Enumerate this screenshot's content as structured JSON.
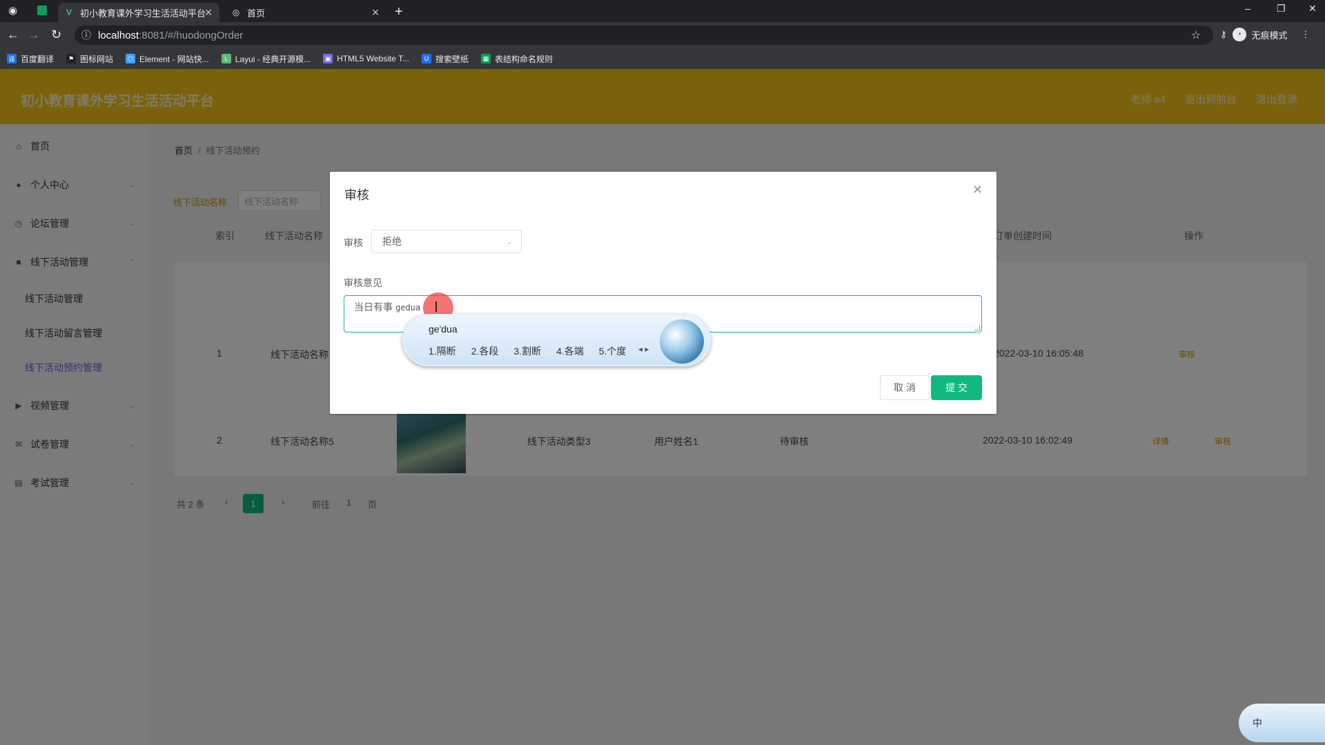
{
  "browser": {
    "tabs": [
      {
        "label": "初小教育课外学习生活活动平台",
        "active": true
      },
      {
        "label": "首页",
        "active": false
      }
    ],
    "url_host": "localhost",
    "url_path": ":8081/#/huodongOrder",
    "profile_label": "无痕模式",
    "bookmarks": [
      {
        "label": "百度翻译",
        "icon": "translate-icon",
        "color": "#1a73e8"
      },
      {
        "label": "图标网站",
        "icon": "flag-icon",
        "color": "#202124"
      },
      {
        "label": "Element - 网站快...",
        "icon": "element-icon",
        "color": "#409eff"
      },
      {
        "label": "Layui - 经典开源模...",
        "icon": "layui-icon",
        "color": "#5fb878"
      },
      {
        "label": "HTML5 Website T...",
        "icon": "html5-icon",
        "color": "#7b68ee"
      },
      {
        "label": "搜索壁纸",
        "icon": "wallpaper-icon",
        "color": "#2a6df4"
      },
      {
        "label": "表结构命名规则",
        "icon": "sheet-icon",
        "color": "#0f9d58"
      }
    ]
  },
  "app": {
    "title": "初小教育课外学习生活活动平台",
    "header_links": [
      "老师 a4",
      "退出到前台",
      "退出登录"
    ],
    "sidebar": {
      "items": [
        {
          "label": "首页",
          "icon": "home-icon"
        },
        {
          "label": "个人中心",
          "icon": "user-icon"
        },
        {
          "label": "论坛管理",
          "icon": "clock-icon"
        },
        {
          "label": "线下活动管理",
          "icon": "folder-icon"
        },
        {
          "label": "视频管理",
          "icon": "video-icon"
        },
        {
          "label": "试卷管理",
          "icon": "mail-icon"
        },
        {
          "label": "考试管理",
          "icon": "briefcase-icon"
        }
      ],
      "sub_items": [
        {
          "label": "线下活动管理",
          "active": false
        },
        {
          "label": "线下活动留言管理",
          "active": false
        },
        {
          "label": "线下活动预约管理",
          "active": true
        }
      ]
    },
    "breadcrumb": {
      "home": "首页",
      "current": "线下活动预约"
    },
    "search": {
      "label": "线下活动名称",
      "placeholder": "线下活动名称"
    },
    "table": {
      "headers": [
        "索引",
        "线下活动名称",
        "订单创建时间",
        "操作"
      ],
      "rows": [
        {
          "index": "1",
          "name": "线下活动名称",
          "type": "",
          "user": "",
          "status": "",
          "time": "2022-03-10 16:05:48",
          "actions": [
            "审核"
          ]
        },
        {
          "index": "2",
          "name": "线下活动名称5",
          "type": "线下活动类型3",
          "user": "用户姓名1",
          "status": "待审核",
          "time": "2022-03-10 16:02:49",
          "actions": [
            "详情",
            "审核"
          ]
        }
      ]
    },
    "pager": {
      "total": "共 2 条",
      "current": "1",
      "goto": "前往",
      "goto_value": "1",
      "page": "页"
    }
  },
  "dialog": {
    "title": "审核",
    "review_label": "审核",
    "review_value": "拒绝",
    "opinion_label": "审核意见",
    "opinion_text": "当日有事",
    "composition": "gedua"
  },
  "ime": {
    "composition": "ge'dua",
    "candidates": [
      "1.隔断",
      "2.各段",
      "3.割断",
      "4.各端",
      "5.个度"
    ],
    "widget_label": "中"
  }
}
